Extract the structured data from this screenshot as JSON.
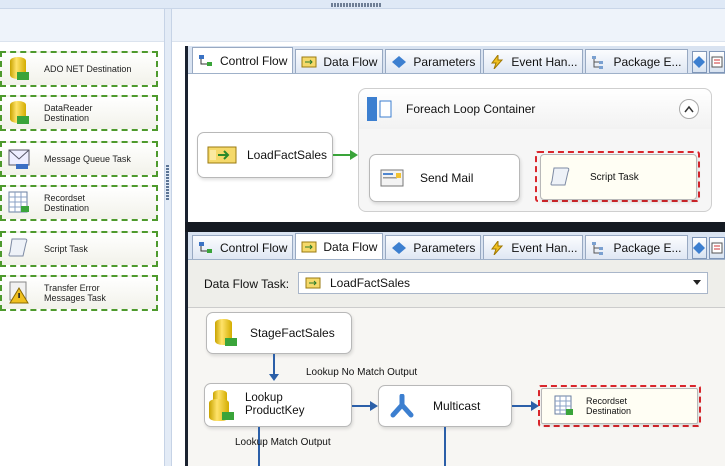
{
  "toolbox": {
    "items": [
      {
        "label": "ADO NET Destination",
        "icon": "database-arrow-icon"
      },
      {
        "label": "DataReader\nDestination",
        "icon": "datareader-icon"
      },
      {
        "label": "Message Queue Task",
        "icon": "envelope-icon"
      },
      {
        "label": "Recordset\nDestination",
        "icon": "recordset-grid-icon"
      },
      {
        "label": "Script Task",
        "icon": "scroll-icon"
      },
      {
        "label": "Transfer Error\nMessages Task",
        "icon": "warning-transfer-icon"
      }
    ]
  },
  "designer1": {
    "tabs": [
      "Control Flow",
      "Data Flow",
      "Parameters",
      "Event Han...",
      "Package E..."
    ],
    "active_tab": "Control Flow",
    "load_task": "LoadFactSales",
    "container_title": "Foreach Loop Container",
    "send_mail": "Send Mail",
    "script_task": "Script Task"
  },
  "designer2": {
    "tabs": [
      "Control Flow",
      "Data Flow",
      "Parameters",
      "Event Han...",
      "Package E..."
    ],
    "active_tab": "Data Flow",
    "task_label": "Data Flow Task:",
    "task_value": "LoadFactSales",
    "stage": "StageFactSales",
    "lookup_no_match": "Lookup No Match Output",
    "lookup": "Lookup\nProductKey",
    "multicast": "Multicast",
    "recordset": "Recordset\nDestination",
    "lookup_match": "Lookup Match Output"
  },
  "colors": {
    "toolbox_border": "#4e9a2d",
    "highlight_border": "#d9262c",
    "connector": "#2b5fa8"
  }
}
